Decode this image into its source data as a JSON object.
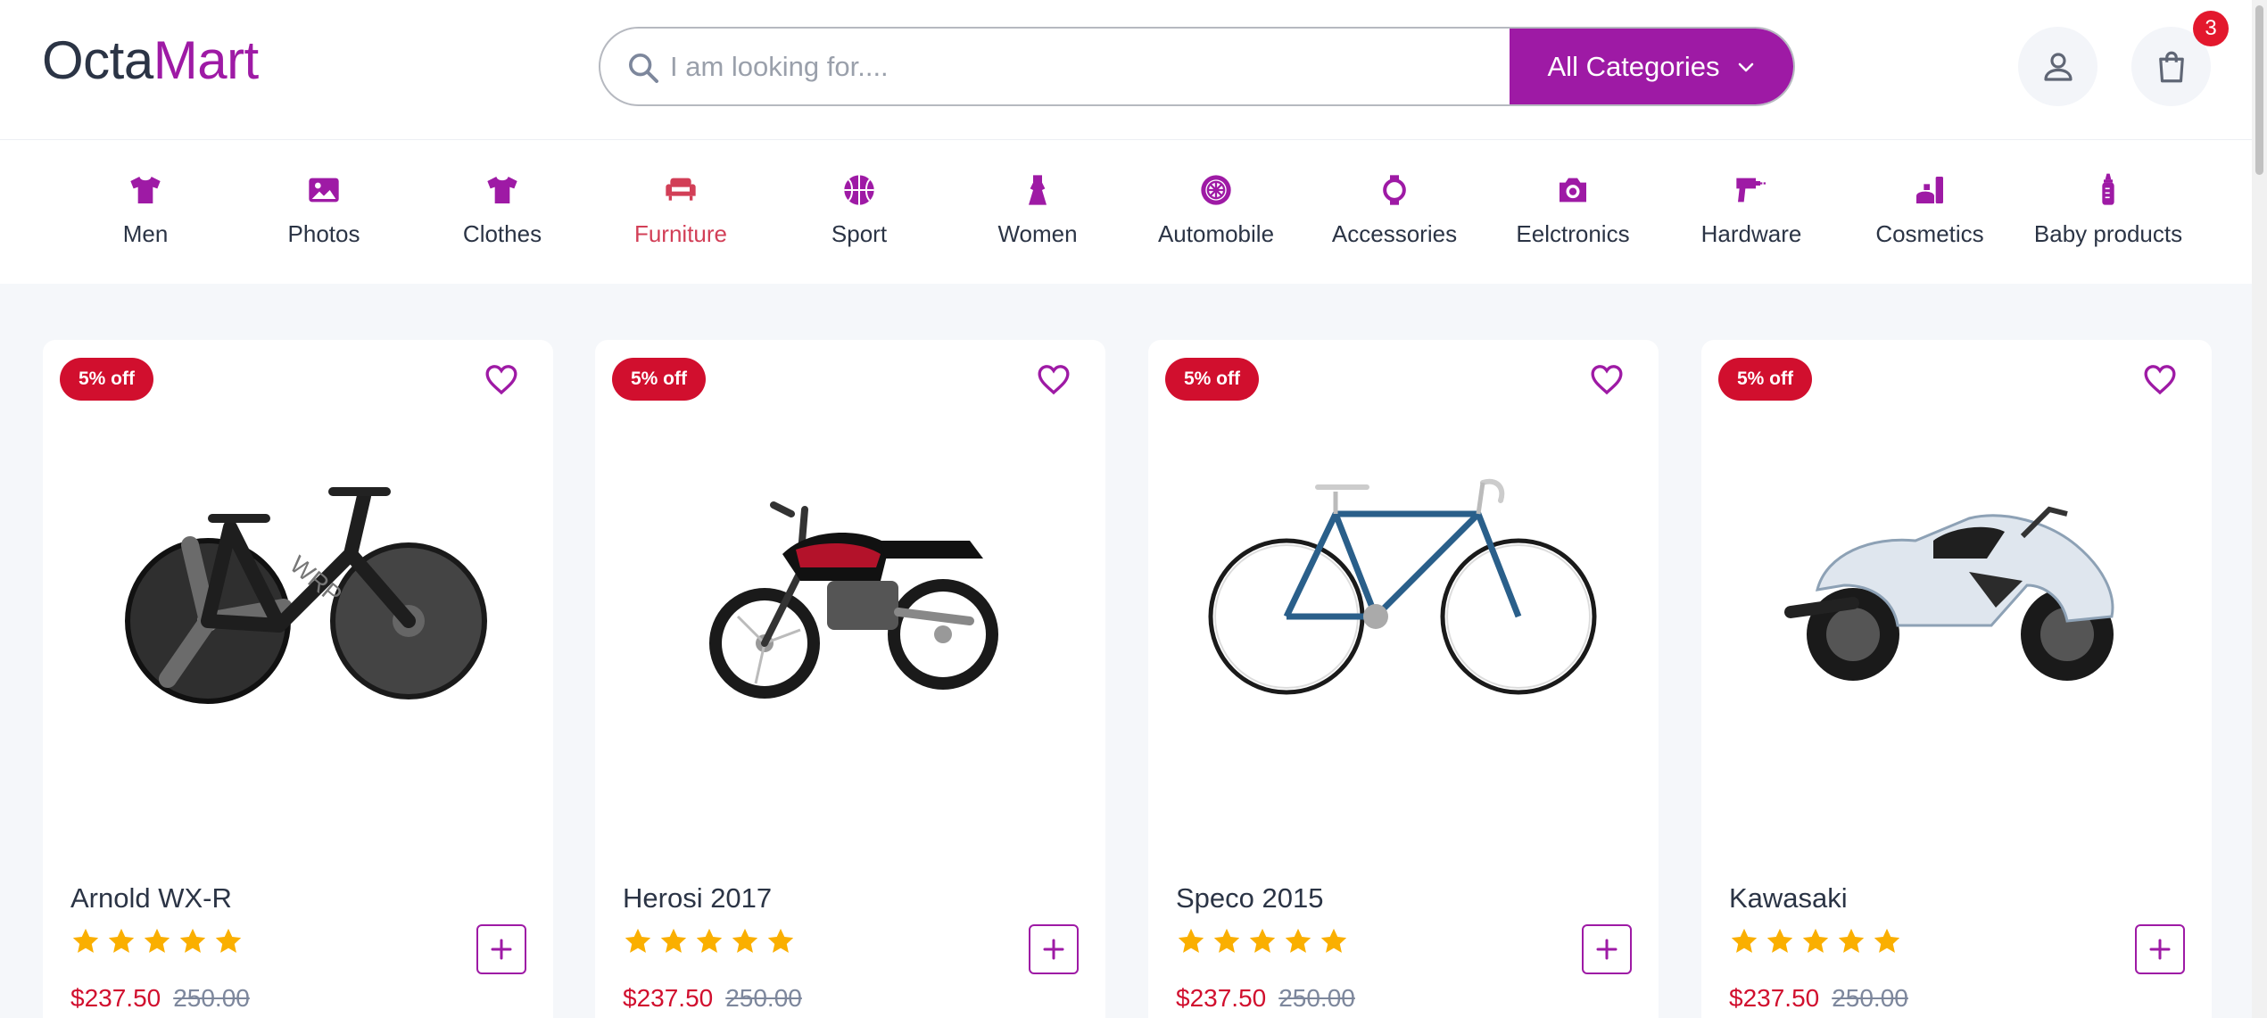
{
  "brand": {
    "part1": "Octa",
    "part2": "Mart"
  },
  "search": {
    "placeholder": "I am looking for....",
    "category_button": "All Categories"
  },
  "cart": {
    "count": "3"
  },
  "categories": [
    {
      "label": "Men",
      "icon": "tshirt-icon"
    },
    {
      "label": "Photos",
      "icon": "image-icon"
    },
    {
      "label": "Clothes",
      "icon": "tshirt-icon"
    },
    {
      "label": "Furniture",
      "icon": "sofa-icon",
      "active": true
    },
    {
      "label": "Sport",
      "icon": "basketball-icon"
    },
    {
      "label": "Women",
      "icon": "dress-icon"
    },
    {
      "label": "Automobile",
      "icon": "wheel-icon"
    },
    {
      "label": "Accessories",
      "icon": "watch-icon"
    },
    {
      "label": "Eelctronics",
      "icon": "camera-icon"
    },
    {
      "label": "Hardware",
      "icon": "drill-icon"
    },
    {
      "label": "Cosmetics",
      "icon": "cosmetics-icon"
    },
    {
      "label": "Baby products",
      "icon": "baby-bottle-icon"
    }
  ],
  "products": [
    {
      "name": "Arnold WX-R",
      "discount": "5% off",
      "price": "$237.50",
      "old_price": "250.00",
      "rating": 5,
      "image": "track-bicycle"
    },
    {
      "name": "Herosi 2017",
      "discount": "5% off",
      "price": "$237.50",
      "old_price": "250.00",
      "rating": 5,
      "image": "motorcycle"
    },
    {
      "name": "Speco 2015",
      "discount": "5% off",
      "price": "$237.50",
      "old_price": "250.00",
      "rating": 5,
      "image": "road-bicycle"
    },
    {
      "name": "Kawasaki",
      "discount": "5% off",
      "price": "$237.50",
      "old_price": "250.00",
      "rating": 5,
      "image": "sport-motorcycle"
    }
  ],
  "colors": {
    "brand": "#9e1aa5",
    "active_category": "#d23f57",
    "discount": "#d10f2e",
    "star": "#faaf00"
  }
}
